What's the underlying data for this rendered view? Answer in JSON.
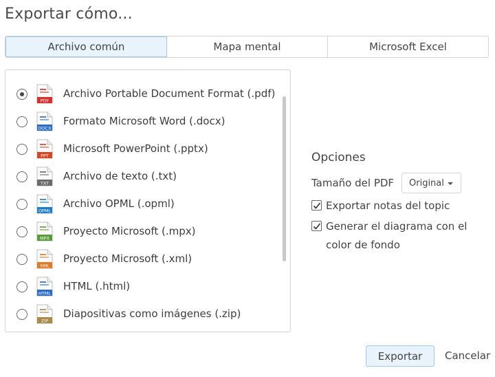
{
  "dialog": {
    "title": "Exportar cómo..."
  },
  "tabs": [
    {
      "label": "Archivo común",
      "active": true
    },
    {
      "label": "Mapa mental",
      "active": false
    },
    {
      "label": "Microsoft Excel",
      "active": false
    }
  ],
  "formats": [
    {
      "label": "Archivo Portable Document Format (.pdf)",
      "icon": "pdf-file-icon",
      "badge": "PDF",
      "color": "#d9302c",
      "selected": true
    },
    {
      "label": "Formato Microsoft Word (.docx)",
      "icon": "docx-file-icon",
      "badge": "DOCX",
      "color": "#2b6cc4",
      "selected": false
    },
    {
      "label": "Microsoft PowerPoint (.pptx)",
      "icon": "pptx-file-icon",
      "badge": "PPT",
      "color": "#d24726",
      "selected": false
    },
    {
      "label": "Archivo de texto (.txt)",
      "icon": "txt-file-icon",
      "badge": "TXT",
      "color": "#6b6b6b",
      "selected": false
    },
    {
      "label": "Archivo OPML (.opml)",
      "icon": "opml-file-icon",
      "badge": "OPML",
      "color": "#1f7cc1",
      "selected": false
    },
    {
      "label": "Proyecto Microsoft (.mpx)",
      "icon": "mpx-file-icon",
      "badge": "MPX",
      "color": "#5a9b3a",
      "selected": false
    },
    {
      "label": "Proyecto Microsoft (.xml)",
      "icon": "xml-file-icon",
      "badge": "XML",
      "color": "#e07a2a",
      "selected": false
    },
    {
      "label": "HTML (.html)",
      "icon": "html-file-icon",
      "badge": "HTML",
      "color": "#2b6cc4",
      "selected": false
    },
    {
      "label": "Diapositivas como imágenes (.zip)",
      "icon": "zip-file-icon",
      "badge": "ZIP",
      "color": "#a88a4a",
      "selected": false
    }
  ],
  "options": {
    "title": "Opciones",
    "pdf_size_label": "Tamaño del PDF",
    "pdf_size_value": "Original",
    "export_notes": {
      "label": "Exportar notas del topic",
      "checked": true
    },
    "background": {
      "line1": "Generar el diagrama con el",
      "line2": "color de fondo",
      "checked": true
    }
  },
  "buttons": {
    "export": "Exportar",
    "cancel": "Cancelar"
  }
}
